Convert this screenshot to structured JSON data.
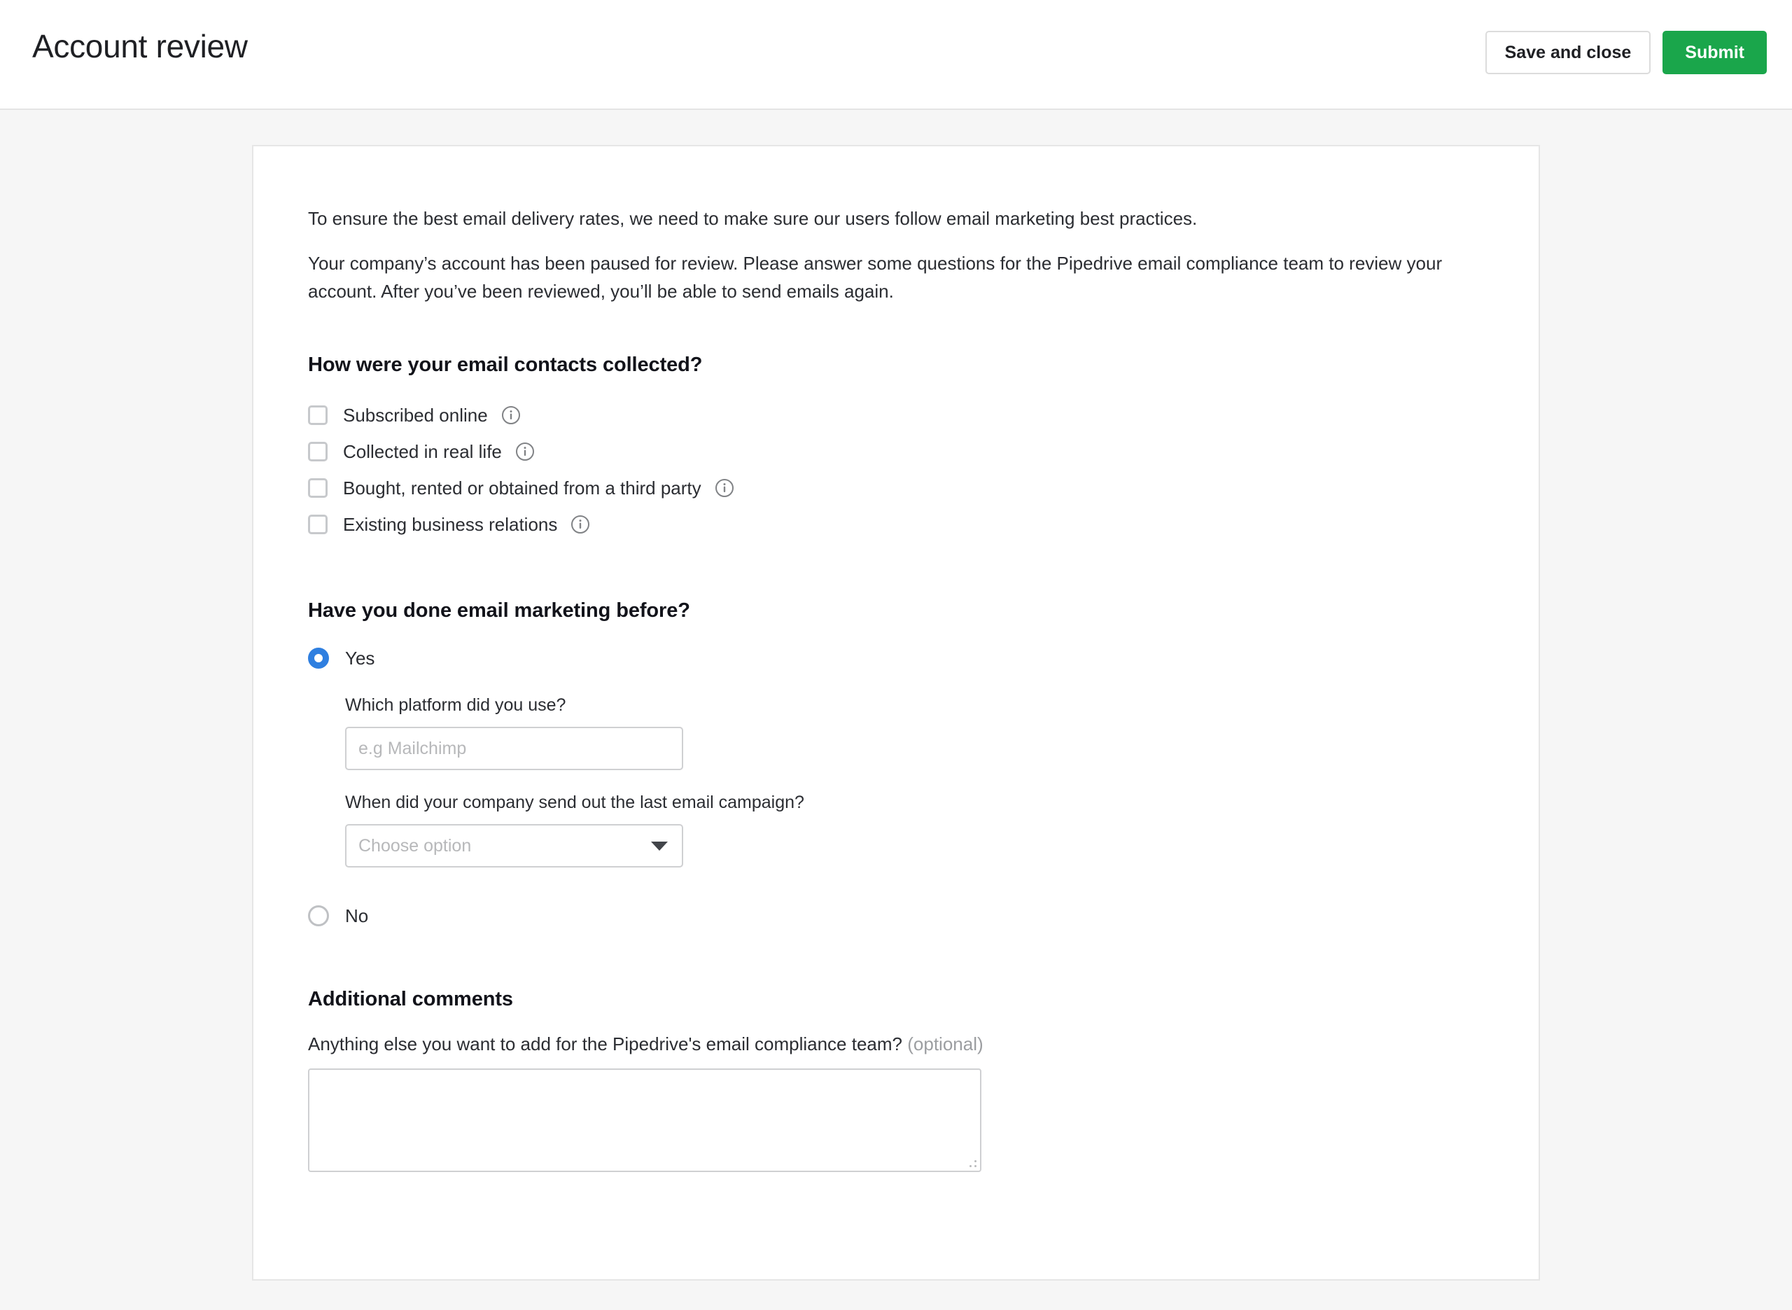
{
  "header": {
    "title": "Account review",
    "save_label": "Save and close",
    "submit_label": "Submit",
    "submit_color": "#1aa64b"
  },
  "intro": {
    "paragraph_1": "To ensure the best email delivery rates, we need to make sure our users follow email marketing best practices.",
    "paragraph_2": "Your company’s account has been paused for review. Please answer some questions for the Pipedrive email compliance team to review your account. After you’ve been reviewed, you’ll be able to send emails again."
  },
  "question_contacts": {
    "title": "How were your email contacts collected?",
    "options": [
      {
        "label": "Subscribed online",
        "checked": false,
        "info": "info-icon"
      },
      {
        "label": "Collected in real life",
        "checked": false,
        "info": "info-icon"
      },
      {
        "label": "Bought, rented or obtained from a third party",
        "checked": false,
        "info": "info-icon"
      },
      {
        "label": "Existing business relations",
        "checked": false,
        "info": "info-icon"
      }
    ]
  },
  "question_marketing": {
    "title": "Have you done email marketing before?",
    "option_yes": "Yes",
    "option_no": "No",
    "selected": "Yes",
    "selected_color": "#2f7fe0",
    "platform": {
      "label": "Which platform did you use?",
      "value": "",
      "placeholder": "e.g Mailchimp"
    },
    "last_campaign": {
      "label": "When did your company send out the last email campaign?",
      "value": "",
      "placeholder": "Choose option"
    }
  },
  "additional_comments": {
    "title": "Additional comments",
    "label": "Anything else you want to add for the Pipedrive's email compliance team?",
    "optional_tag": "(optional)",
    "value": ""
  }
}
